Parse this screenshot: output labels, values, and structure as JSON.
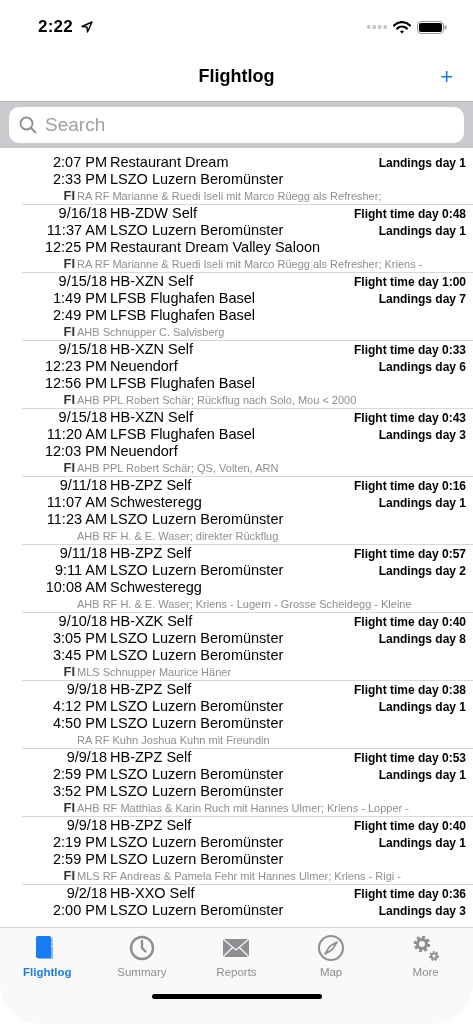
{
  "status_bar": {
    "time": "2:22"
  },
  "nav_bar": {
    "title": "Flightlog",
    "add_button": "+"
  },
  "search": {
    "placeholder": "Search"
  },
  "entries": [
    {
      "departure_time": "2:07 PM",
      "departure": "Restaurant Dream",
      "landings": "Landings day 1",
      "arrival_time": "2:33 PM",
      "arrival": "LSZO Luzern Beromünster",
      "role": "FI",
      "remarks": "RA RF Marianne & Ruedi Iseli mit Marco Rüegg als Refresher;"
    },
    {
      "date": "9/16/18",
      "aircraft": "HB-ZDW Self",
      "flight_time": "Flight time day 0:48",
      "departure_time": "11:37 AM",
      "departure": "LSZO Luzern Beromünster",
      "landings": "Landings day 1",
      "arrival_time": "12:25 PM",
      "arrival": "Restaurant Dream Valley Saloon",
      "role": "FI",
      "remarks": "RA RF Marianne & Ruedi Iseli mit Marco Rüegg als Refresher; Kriens -"
    },
    {
      "date": "9/15/18",
      "aircraft": "HB-XZN Self",
      "flight_time": "Flight time day 1:00",
      "departure_time": "1:49 PM",
      "departure": "LFSB Flughafen Basel",
      "landings": "Landings day 7",
      "arrival_time": "2:49 PM",
      "arrival": "LFSB Flughafen Basel",
      "role": "FI",
      "remarks": "AHB Schnupper C. Salvisberg"
    },
    {
      "date": "9/15/18",
      "aircraft": "HB-XZN Self",
      "flight_time": "Flight time day 0:33",
      "departure_time": "12:23 PM",
      "departure": "Neuendorf",
      "landings": "Landings day 6",
      "arrival_time": "12:56 PM",
      "arrival": "LFSB Flughafen Basel",
      "role": "FI",
      "remarks": "AHB PPL Robert Schär; Rückflug nach Solo, Mou < 2000"
    },
    {
      "date": "9/15/18",
      "aircraft": "HB-XZN Self",
      "flight_time": "Flight time day 0:43",
      "departure_time": "11:20 AM",
      "departure": "LFSB Flughafen Basel",
      "landings": "Landings day 3",
      "arrival_time": "12:03 PM",
      "arrival": "Neuendorf",
      "role": "FI",
      "remarks": "AHB PPL Robert Schär; QS, Volten, ARN"
    },
    {
      "date": "9/11/18",
      "aircraft": "HB-ZPZ Self",
      "flight_time": "Flight time day 0:16",
      "departure_time": "11:07 AM",
      "departure": "Schwesteregg",
      "landings": "Landings day 1",
      "arrival_time": "11:23 AM",
      "arrival": "LSZO Luzern Beromünster",
      "remarks": "AHB RF H. & E. Waser; direkter Rückflug"
    },
    {
      "date": "9/11/18",
      "aircraft": "HB-ZPZ Self",
      "flight_time": "Flight time day 0:57",
      "departure_time": "9:11 AM",
      "departure": "LSZO Luzern Beromünster",
      "landings": "Landings day 2",
      "arrival_time": "10:08 AM",
      "arrival": "Schwesteregg",
      "remarks": "AHB RF H. & E. Waser; Kriens - Lugern - Grosse Scheidegg - Kleine"
    },
    {
      "date": "9/10/18",
      "aircraft": "HB-XZK Self",
      "flight_time": "Flight time day 0:40",
      "departure_time": "3:05 PM",
      "departure": "LSZO Luzern Beromünster",
      "landings": "Landings day 8",
      "arrival_time": "3:45 PM",
      "arrival": "LSZO Luzern Beromünster",
      "role": "FI",
      "remarks": "MLS Schnupper Maurice Häner"
    },
    {
      "date": "9/9/18",
      "aircraft": "HB-ZPZ Self",
      "flight_time": "Flight time day 0:38",
      "departure_time": "4:12 PM",
      "departure": "LSZO Luzern Beromünster",
      "landings": "Landings day 1",
      "arrival_time": "4:50 PM",
      "arrival": "LSZO Luzern Beromünster",
      "remarks": "RA RF Kuhn Joshua Kuhn mit Freundin"
    },
    {
      "date": "9/9/18",
      "aircraft": "HB-ZPZ Self",
      "flight_time": "Flight time day 0:53",
      "departure_time": "2:59 PM",
      "departure": "LSZO Luzern Beromünster",
      "landings": "Landings day 1",
      "arrival_time": "3:52 PM",
      "arrival": "LSZO Luzern Beromünster",
      "role": "FI",
      "remarks": "AHB RF Matthias & Karin Ruch mit Hannes Ulmer; Kriens - Lopper -"
    },
    {
      "date": "9/9/18",
      "aircraft": "HB-ZPZ Self",
      "flight_time": "Flight time day 0:40",
      "departure_time": "2:19 PM",
      "departure": "LSZO Luzern Beromünster",
      "landings": "Landings day 1",
      "arrival_time": "2:59 PM",
      "arrival": "LSZO Luzern Beromünster",
      "role": "FI",
      "remarks": "MLS RF Andreas & Pamela Fehr mit Hannes Ulmer; Kriens - Rigi -"
    },
    {
      "date": "9/2/18",
      "aircraft": "HB-XXO Self",
      "flight_time": "Flight time day 0:36",
      "departure_time": "2:00 PM",
      "departure": "LSZO Luzern Beromünster",
      "landings": "Landings day 3"
    }
  ],
  "tab_bar": [
    {
      "label": "Flightlog",
      "selected": true
    },
    {
      "label": "Summary",
      "selected": false
    },
    {
      "label": "Reports",
      "selected": false
    },
    {
      "label": "Map",
      "selected": false
    },
    {
      "label": "More",
      "selected": false
    }
  ]
}
